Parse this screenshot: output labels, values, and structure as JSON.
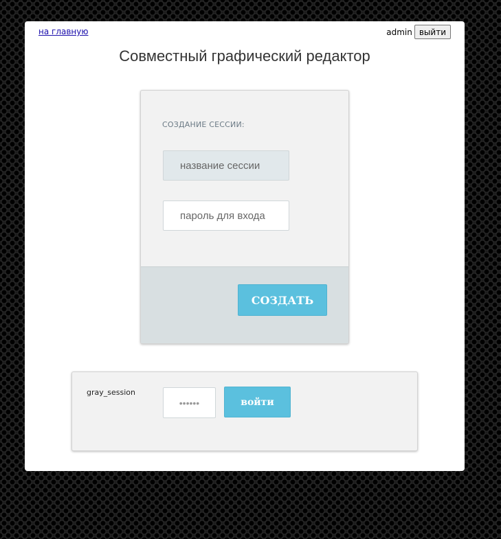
{
  "header": {
    "home_link": "на главную",
    "username": "admin",
    "logout_label": "выйти"
  },
  "title": "Совместный графический редактор",
  "create_session": {
    "heading": "СОЗДАНИЕ СЕССИИ:",
    "name_placeholder": "название сессии",
    "password_placeholder": "пароль для входа",
    "create_label": "СОЗДАТЬ"
  },
  "sessions": [
    {
      "name": "gray_session",
      "password_value": "••••••",
      "join_label": "войти"
    }
  ],
  "colors": {
    "accent": "#5bc0de",
    "panel_bg": "#ffffff",
    "card_bg": "#f2f2f2"
  }
}
